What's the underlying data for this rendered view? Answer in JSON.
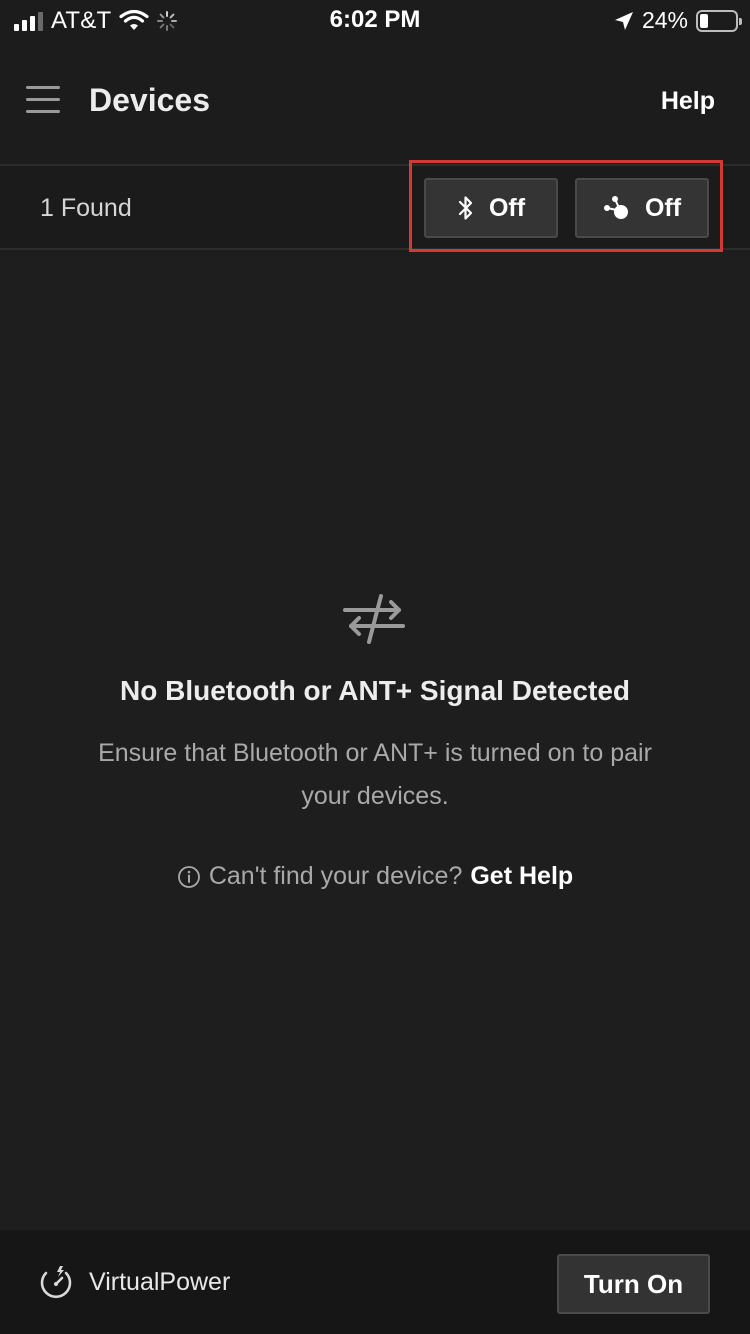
{
  "status_bar": {
    "carrier": "AT&T",
    "time": "6:02 PM",
    "battery_percent": "24%",
    "battery_level": 0.24,
    "icons": [
      "signal-icon",
      "wifi-icon",
      "activity-spinner-icon",
      "location-arrow-icon",
      "battery-icon"
    ]
  },
  "header": {
    "title": "Devices",
    "help_label": "Help",
    "menu_icon": "hamburger-menu-icon"
  },
  "found_bar": {
    "count_label": "1 Found",
    "bluetooth_toggle": {
      "icon": "bluetooth-icon",
      "label": "Off"
    },
    "ant_toggle": {
      "icon": "ant-plus-icon",
      "label": "Off"
    },
    "highlight_color": "#d23a34"
  },
  "empty_state": {
    "icon": "transfer-arrows-icon",
    "title": "No Bluetooth or ANT+ Signal Detected",
    "description": "Ensure that Bluetooth or ANT+ is turned on to pair your devices.",
    "help_question": "Can't find your device?",
    "help_link": "Get Help"
  },
  "footer": {
    "icon": "virtualpower-icon",
    "label": "VirtualPower",
    "button_label": "Turn On"
  }
}
